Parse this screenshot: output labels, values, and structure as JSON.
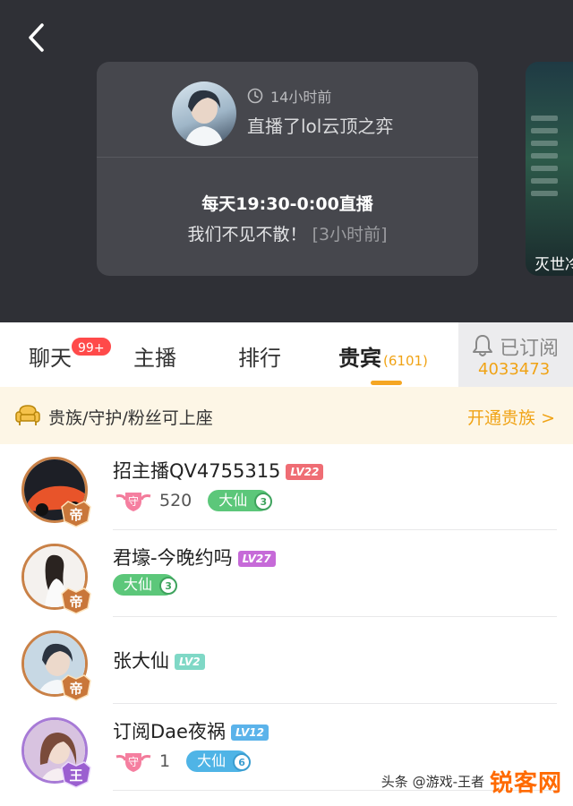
{
  "header": {
    "card": {
      "time_ago": "14小时前",
      "live_text": "直播了lol云顶之弈",
      "schedule": "每天19:30-0:00直播",
      "notice": "我们不见不散！",
      "notice_ago": "[3小时前]"
    },
    "side_card_caption": "灭世冷"
  },
  "tabs": {
    "items": [
      {
        "label": "聊天"
      },
      {
        "label": "主播"
      },
      {
        "label": "排行"
      },
      {
        "label": "贵宾",
        "count": "(6101)"
      }
    ],
    "chat_badge": "99+",
    "subscribe": {
      "label": "已订阅",
      "count": "4033473"
    }
  },
  "banner": {
    "text": "贵族/守护/粉丝可上座",
    "action": "开通贵族 >"
  },
  "guests": [
    {
      "name": "招主播QV4755315",
      "level": "LV22",
      "level_color": "#ef6d74",
      "rank": "帝",
      "guard": "守",
      "guard_num": "520",
      "fan_label": "大仙",
      "fan_level": "3",
      "fan_color": "green"
    },
    {
      "name": "君壕-今晚约吗",
      "level": "LV27",
      "level_color": "#c66ad8",
      "rank": "帝",
      "fan_label": "大仙",
      "fan_level": "3",
      "fan_color": "green"
    },
    {
      "name": "张大仙",
      "level": "LV2",
      "level_color": "#7fd8c6",
      "rank": "帝"
    },
    {
      "name": "订阅Dae夜祸",
      "level": "LV12",
      "level_color": "#5bb3ea",
      "rank": "王",
      "guard": "守",
      "guard_num": "1",
      "fan_label": "大仙",
      "fan_level": "6",
      "fan_color": "blue"
    }
  ],
  "watermark": {
    "text": "头条 @游戏-王者",
    "logo": "锐客网"
  },
  "colors": {
    "accent": "#f5a623",
    "badge": "#ff4a4a",
    "dark_bg": "#2f3036"
  }
}
